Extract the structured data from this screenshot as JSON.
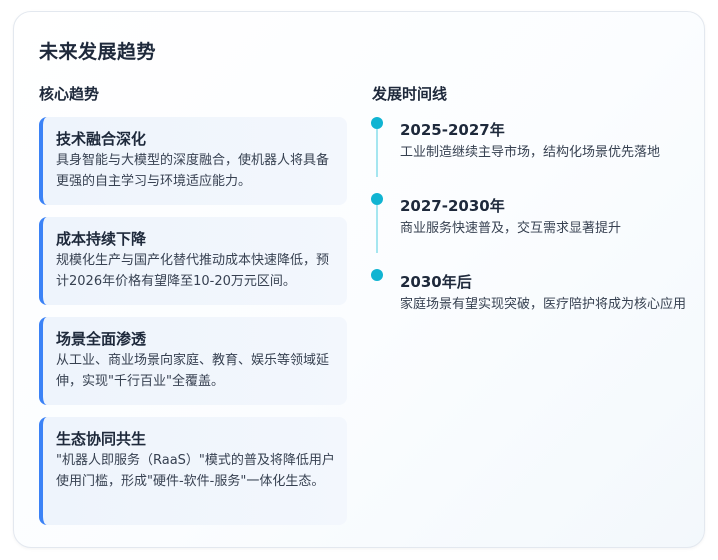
{
  "page": {
    "title": "未来发展趋势"
  },
  "trends": {
    "heading": "核心趋势",
    "items": [
      {
        "title": "技术融合深化",
        "desc": "具身智能与大模型的深度融合，使机器人将具备更强的自主学习与环境适应能力。"
      },
      {
        "title": "成本持续下降",
        "desc": "规模化生产与国产化替代推动成本快速降低，预计2026年价格有望降至10-20万元区间。"
      },
      {
        "title": "场景全面渗透",
        "desc": "从工业、商业场景向家庭、教育、娱乐等领域延伸，实现\"千行百业\"全覆盖。"
      },
      {
        "title": "生态协同共生",
        "desc": "\"机器人即服务（RaaS）\"模式的普及将降低用户使用门槛，形成\"硬件-软件-服务\"一体化生态。"
      }
    ]
  },
  "timeline": {
    "heading": "发展时间线",
    "items": [
      {
        "year": "2025-2027年",
        "desc": "工业制造继续主导市场，结构化场景优先落地"
      },
      {
        "year": "2027-2030年",
        "desc": "商业服务快速普及，交互需求显著提升"
      },
      {
        "year": "2030年后",
        "desc": "家庭场景有望实现突破，医疗陪护将成为核心应用"
      }
    ]
  },
  "colors": {
    "accent_blue": "#3b82f6",
    "timeline_dot": "#10b4d2",
    "timeline_line": "#a5e6f0"
  }
}
